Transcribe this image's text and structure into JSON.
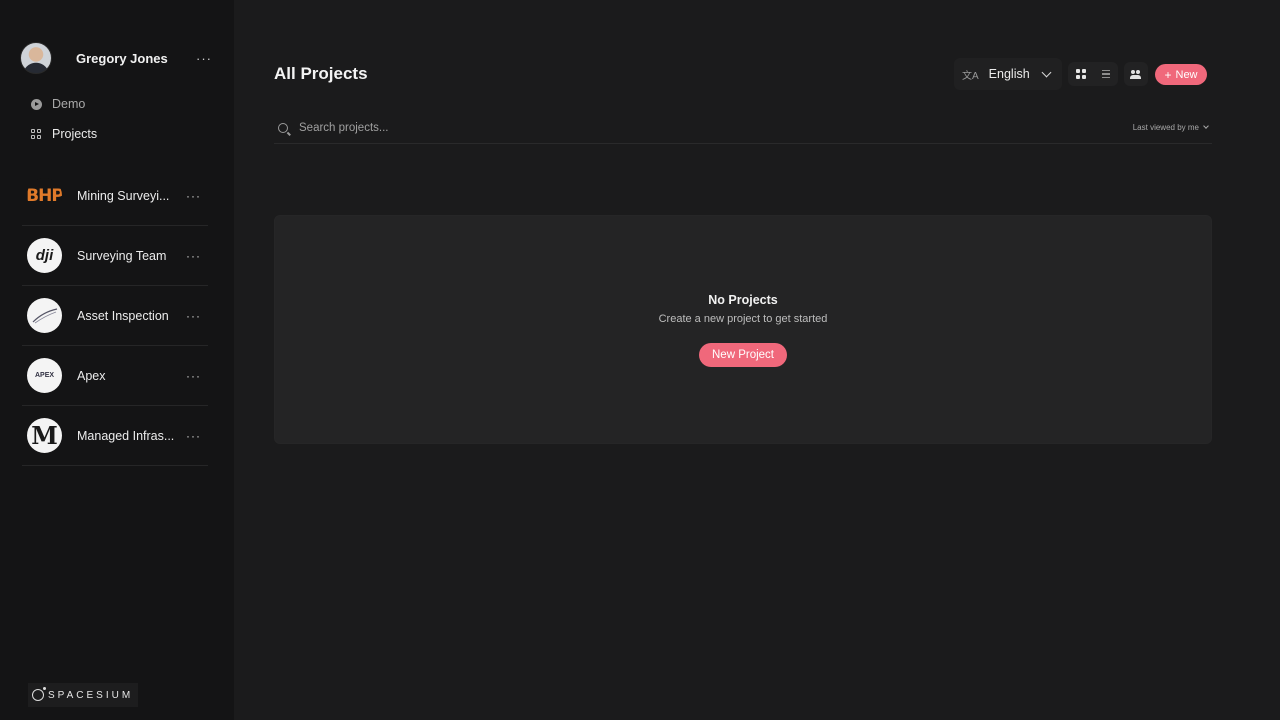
{
  "user": {
    "name": "Gregory Jones",
    "menu": "···"
  },
  "nav": [
    {
      "label": "Demo",
      "icon": "play-circle-icon"
    },
    {
      "label": "Projects",
      "icon": "grid-icon"
    }
  ],
  "teams": [
    {
      "label": "Mining Surveyi...",
      "logo_text": "BHP",
      "icon": "bhp-logo"
    },
    {
      "label": "Surveying Team",
      "logo_text": "dji",
      "icon": "dji-logo"
    },
    {
      "label": "Asset Inspection",
      "logo_text": "",
      "icon": "asset-inspection-logo"
    },
    {
      "label": "Apex",
      "logo_text": "APEX",
      "icon": "apex-logo"
    },
    {
      "label": "Managed Infras...",
      "logo_text": "M",
      "icon": "managed-infrastructure-logo"
    }
  ],
  "brand": {
    "name": "SPACESIUM"
  },
  "header": {
    "title": "All Projects",
    "language": "English",
    "lang_icon_glyph": "文A",
    "new_label": "New"
  },
  "search": {
    "placeholder": "Search projects...",
    "sort_label": "Last viewed by me"
  },
  "empty_state": {
    "title": "No Projects",
    "subtitle": "Create a new project to get started",
    "button": "New Project"
  },
  "colors": {
    "accent": "#f0687b",
    "background": "#1b1b1c",
    "sidebar": "#141415",
    "bhp_orange": "#e07a2a"
  }
}
